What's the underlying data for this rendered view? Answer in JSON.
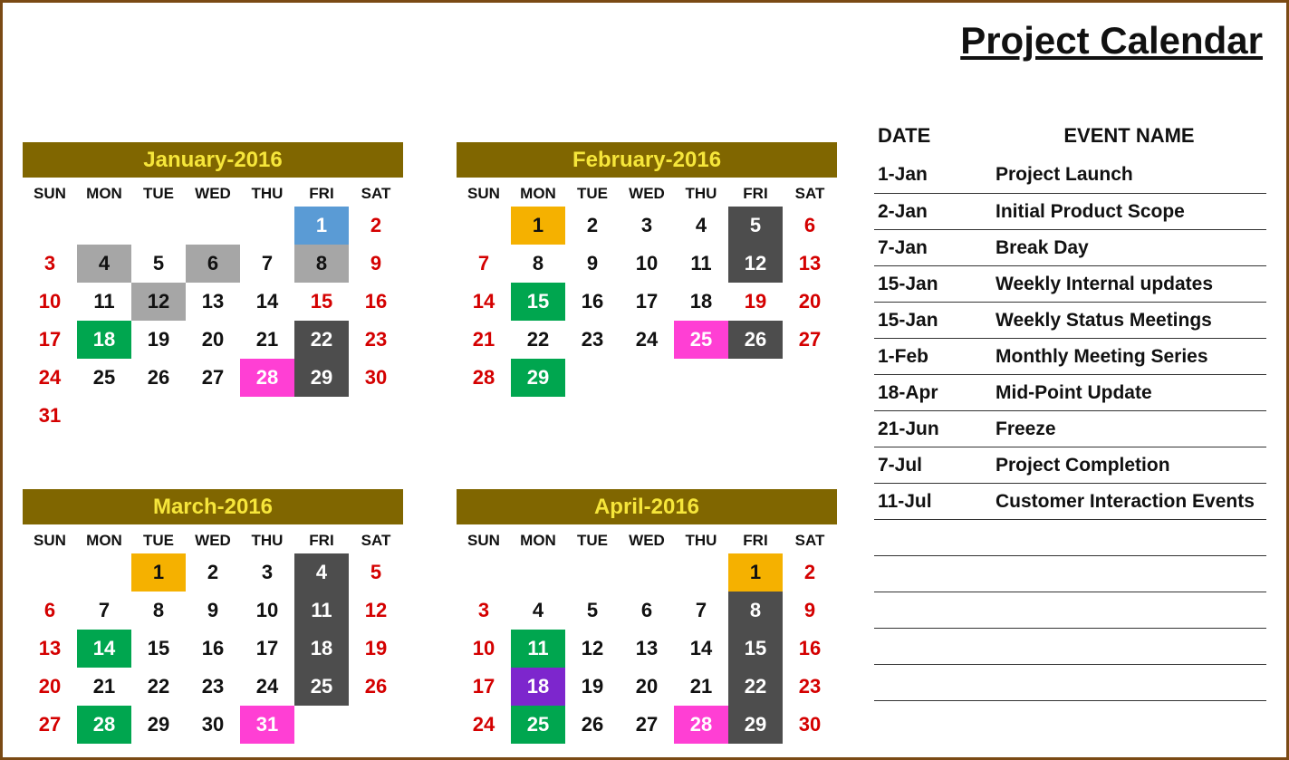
{
  "title": "Project Calendar",
  "dow": [
    "SUN",
    "MON",
    "TUE",
    "WED",
    "THU",
    "FRI",
    "SAT"
  ],
  "months": [
    {
      "title": "January-2016",
      "weeks": [
        [
          null,
          null,
          null,
          null,
          null,
          {
            "d": "1",
            "c": "blue"
          },
          {
            "d": "2",
            "c": "wknd"
          }
        ],
        [
          {
            "d": "3",
            "c": "wknd"
          },
          {
            "d": "4",
            "c": "gray"
          },
          {
            "d": "5"
          },
          {
            "d": "6",
            "c": "gray"
          },
          {
            "d": "7"
          },
          {
            "d": "8",
            "c": "gray"
          },
          {
            "d": "9",
            "c": "wknd"
          }
        ],
        [
          {
            "d": "10",
            "c": "wknd"
          },
          {
            "d": "11"
          },
          {
            "d": "12",
            "c": "gray"
          },
          {
            "d": "13"
          },
          {
            "d": "14"
          },
          {
            "d": "15",
            "c": "redtxt"
          },
          {
            "d": "16",
            "c": "wknd"
          }
        ],
        [
          {
            "d": "17",
            "c": "wknd"
          },
          {
            "d": "18",
            "c": "green"
          },
          {
            "d": "19"
          },
          {
            "d": "20"
          },
          {
            "d": "21"
          },
          {
            "d": "22",
            "c": "dark"
          },
          {
            "d": "23",
            "c": "wknd"
          }
        ],
        [
          {
            "d": "24",
            "c": "wknd"
          },
          {
            "d": "25"
          },
          {
            "d": "26"
          },
          {
            "d": "27"
          },
          {
            "d": "28",
            "c": "pink"
          },
          {
            "d": "29",
            "c": "dark"
          },
          {
            "d": "30",
            "c": "wknd"
          }
        ],
        [
          {
            "d": "31",
            "c": "wknd"
          },
          null,
          null,
          null,
          null,
          null,
          null
        ]
      ]
    },
    {
      "title": "February-2016",
      "weeks": [
        [
          null,
          {
            "d": "1",
            "c": "orange"
          },
          {
            "d": "2"
          },
          {
            "d": "3"
          },
          {
            "d": "4"
          },
          {
            "d": "5",
            "c": "dark"
          },
          {
            "d": "6",
            "c": "wknd"
          }
        ],
        [
          {
            "d": "7",
            "c": "wknd"
          },
          {
            "d": "8"
          },
          {
            "d": "9"
          },
          {
            "d": "10"
          },
          {
            "d": "11"
          },
          {
            "d": "12",
            "c": "dark"
          },
          {
            "d": "13",
            "c": "wknd"
          }
        ],
        [
          {
            "d": "14",
            "c": "wknd"
          },
          {
            "d": "15",
            "c": "green"
          },
          {
            "d": "16"
          },
          {
            "d": "17"
          },
          {
            "d": "18"
          },
          {
            "d": "19",
            "c": "redtxt"
          },
          {
            "d": "20",
            "c": "wknd"
          }
        ],
        [
          {
            "d": "21",
            "c": "wknd"
          },
          {
            "d": "22"
          },
          {
            "d": "23"
          },
          {
            "d": "24"
          },
          {
            "d": "25",
            "c": "pink"
          },
          {
            "d": "26",
            "c": "dark"
          },
          {
            "d": "27",
            "c": "wknd"
          }
        ],
        [
          {
            "d": "28",
            "c": "wknd"
          },
          {
            "d": "29",
            "c": "green"
          },
          null,
          null,
          null,
          null,
          null
        ]
      ]
    },
    {
      "title": "March-2016",
      "weeks": [
        [
          null,
          null,
          {
            "d": "1",
            "c": "orange"
          },
          {
            "d": "2"
          },
          {
            "d": "3"
          },
          {
            "d": "4",
            "c": "dark"
          },
          {
            "d": "5",
            "c": "wknd"
          }
        ],
        [
          {
            "d": "6",
            "c": "wknd"
          },
          {
            "d": "7"
          },
          {
            "d": "8"
          },
          {
            "d": "9"
          },
          {
            "d": "10"
          },
          {
            "d": "11",
            "c": "dark"
          },
          {
            "d": "12",
            "c": "wknd"
          }
        ],
        [
          {
            "d": "13",
            "c": "wknd"
          },
          {
            "d": "14",
            "c": "green"
          },
          {
            "d": "15"
          },
          {
            "d": "16"
          },
          {
            "d": "17"
          },
          {
            "d": "18",
            "c": "dark"
          },
          {
            "d": "19",
            "c": "wknd"
          }
        ],
        [
          {
            "d": "20",
            "c": "wknd"
          },
          {
            "d": "21"
          },
          {
            "d": "22"
          },
          {
            "d": "23"
          },
          {
            "d": "24"
          },
          {
            "d": "25",
            "c": "dark"
          },
          {
            "d": "26",
            "c": "wknd"
          }
        ],
        [
          {
            "d": "27",
            "c": "wknd"
          },
          {
            "d": "28",
            "c": "green"
          },
          {
            "d": "29"
          },
          {
            "d": "30"
          },
          {
            "d": "31",
            "c": "pink"
          },
          null,
          null
        ]
      ]
    },
    {
      "title": "April-2016",
      "weeks": [
        [
          null,
          null,
          null,
          null,
          null,
          {
            "d": "1",
            "c": "orange"
          },
          {
            "d": "2",
            "c": "wknd"
          }
        ],
        [
          {
            "d": "3",
            "c": "wknd"
          },
          {
            "d": "4"
          },
          {
            "d": "5"
          },
          {
            "d": "6"
          },
          {
            "d": "7"
          },
          {
            "d": "8",
            "c": "dark"
          },
          {
            "d": "9",
            "c": "wknd"
          }
        ],
        [
          {
            "d": "10",
            "c": "wknd"
          },
          {
            "d": "11",
            "c": "green"
          },
          {
            "d": "12"
          },
          {
            "d": "13"
          },
          {
            "d": "14"
          },
          {
            "d": "15",
            "c": "dark"
          },
          {
            "d": "16",
            "c": "wknd"
          }
        ],
        [
          {
            "d": "17",
            "c": "wknd"
          },
          {
            "d": "18",
            "c": "purple"
          },
          {
            "d": "19"
          },
          {
            "d": "20"
          },
          {
            "d": "21"
          },
          {
            "d": "22",
            "c": "dark"
          },
          {
            "d": "23",
            "c": "wknd"
          }
        ],
        [
          {
            "d": "24",
            "c": "wknd"
          },
          {
            "d": "25",
            "c": "green"
          },
          {
            "d": "26"
          },
          {
            "d": "27"
          },
          {
            "d": "28",
            "c": "pink"
          },
          {
            "d": "29",
            "c": "dark"
          },
          {
            "d": "30",
            "c": "wknd"
          }
        ]
      ]
    }
  ],
  "events": {
    "headers": {
      "date": "DATE",
      "name": "EVENT NAME"
    },
    "rows": [
      {
        "date": "1-Jan",
        "name": "Project Launch"
      },
      {
        "date": "2-Jan",
        "name": "Initial Product Scope"
      },
      {
        "date": "7-Jan",
        "name": "Break Day"
      },
      {
        "date": "15-Jan",
        "name": "Weekly Internal updates"
      },
      {
        "date": "15-Jan",
        "name": "Weekly Status Meetings"
      },
      {
        "date": "1-Feb",
        "name": "Monthly Meeting Series"
      },
      {
        "date": "18-Apr",
        "name": "Mid-Point Update"
      },
      {
        "date": "21-Jun",
        "name": "Freeze"
      },
      {
        "date": "7-Jul",
        "name": "Project Completion"
      },
      {
        "date": "11-Jul",
        "name": "Customer Interaction Events"
      }
    ],
    "emptyRows": 5
  }
}
